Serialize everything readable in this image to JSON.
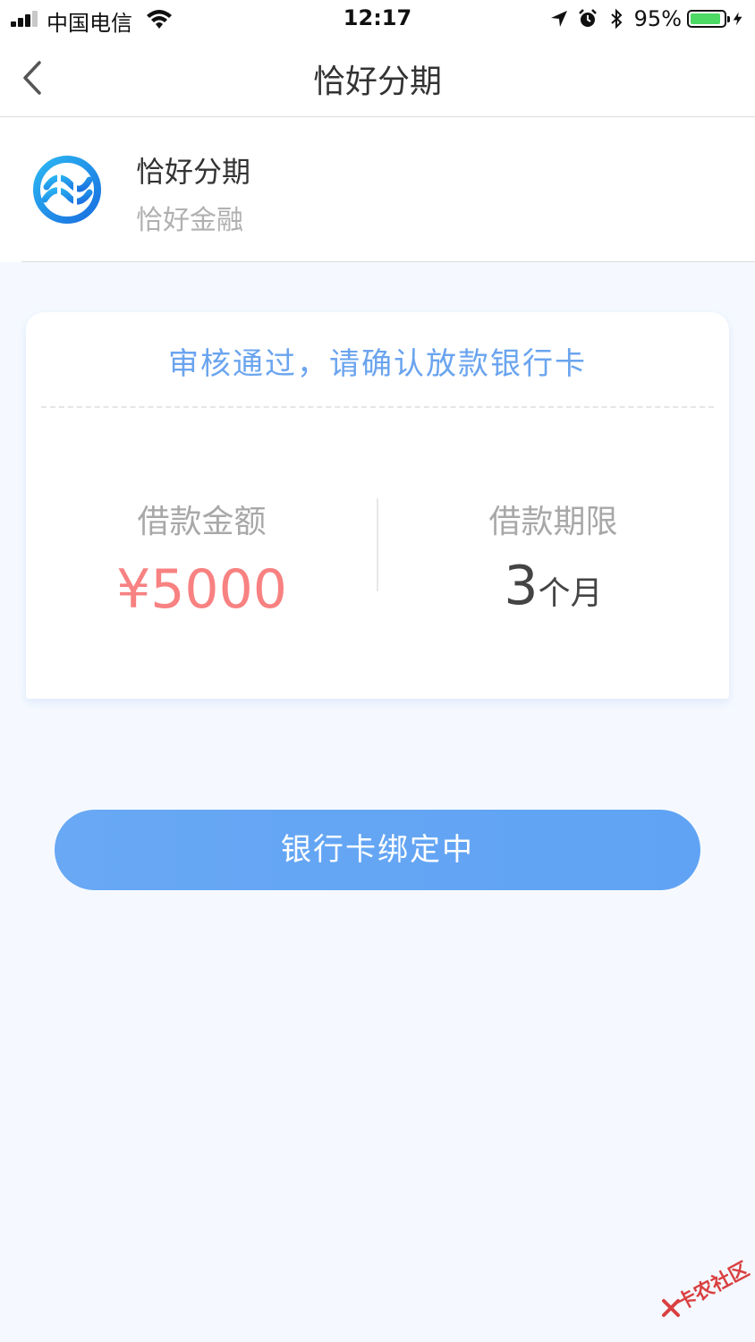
{
  "status_bar": {
    "carrier": "中国电信",
    "time": "12:17",
    "battery_percent": "95%",
    "battery_level": 0.95,
    "icons": [
      "signal-icon",
      "wifi-icon",
      "location-icon",
      "alarm-icon",
      "bluetooth-icon",
      "battery-icon",
      "charging-icon"
    ]
  },
  "nav": {
    "title": "恰好分期",
    "back_icon": "chevron-left-icon"
  },
  "app_info": {
    "name": "恰好分期",
    "company": "恰好金融",
    "logo_icon": "app-logo-icon"
  },
  "card": {
    "header": "审核通过，请确认放款银行卡",
    "amount_label": "借款金额",
    "amount_value": "¥5000",
    "term_label": "借款期限",
    "term_number": "3",
    "term_unit": "个月"
  },
  "button": {
    "label": "银行卡绑定中"
  },
  "watermark": {
    "text": "卡农社区"
  },
  "colors": {
    "accent_blue": "#6aa4ef",
    "button_blue": "#66a7f4",
    "amount_red": "#f88181",
    "page_bg": "#f5f9ff",
    "battery_green": "#4cd964"
  }
}
